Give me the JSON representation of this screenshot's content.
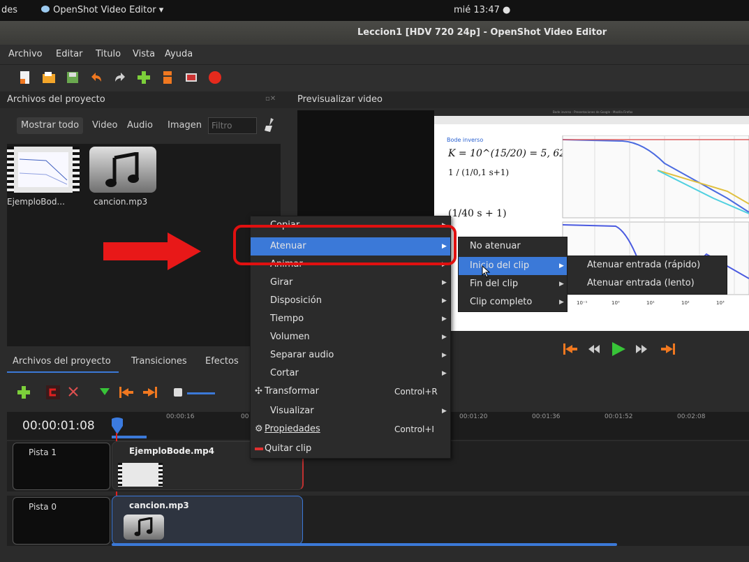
{
  "system_bar": {
    "activities": "des",
    "app_menu": "OpenShot Video Editor ▾",
    "clock": "mié 13:47 ●"
  },
  "window": {
    "title": "Leccion1 [HDV 720 24p] - OpenShot Video Editor"
  },
  "menu": [
    "Archivo",
    "Editar",
    "Titulo",
    "Vista",
    "Ayuda"
  ],
  "toolbar_icons": [
    "new-project-icon",
    "open-project-icon",
    "save-project-icon",
    "undo-icon",
    "redo-icon",
    "import-files-icon",
    "choose-profile-icon",
    "fullscreen-icon",
    "export-video-icon"
  ],
  "project_panel": {
    "title": "Archivos del proyecto",
    "filters": [
      "Mostrar todo",
      "Video",
      "Audio",
      "Imagen"
    ],
    "filter_placeholder": "Filtro",
    "files": [
      {
        "name": "EjemploBod...",
        "type": "video"
      },
      {
        "name": "cancion.mp3",
        "type": "audio"
      }
    ]
  },
  "preview_panel": {
    "title": "Previsualizar video"
  },
  "slide": {
    "window_title": "Bode inverso - Presentaciones de Google - Mozilla Firefox",
    "heading": "Bode inverso",
    "eq1": "K = 10^(15/20) = 5, 62",
    "eq_frac": "1 / (1/0,1 s+1)",
    "eq2": "(1/40 s + 1)",
    "axis_ticks": [
      "10⁻¹",
      "10⁰",
      "10¹",
      "10²",
      "10³"
    ]
  },
  "bottom_tabs": [
    "Archivos del proyecto",
    "Transiciones",
    "Efectos"
  ],
  "timeline": {
    "timecode": "00:00:01:08",
    "ticks": [
      "00:00:16",
      "00",
      "00:01:20",
      "00:01:36",
      "00:01:52",
      "00:02:08"
    ],
    "tracks": [
      {
        "name": "Pista 1",
        "clip": "EjemploBode.mp4"
      },
      {
        "name": "Pista 0",
        "clip": "cancion.mp3"
      }
    ]
  },
  "context_menu": {
    "items": [
      {
        "label": "Copiar",
        "submenu": true
      },
      {
        "label": "Atenuar",
        "submenu": true,
        "highlighted": true
      },
      {
        "label": "Animar",
        "submenu": true
      },
      {
        "label": "Girar",
        "submenu": true
      },
      {
        "label": "Disposición",
        "submenu": true
      },
      {
        "label": "Tiempo",
        "submenu": true
      },
      {
        "label": "Volumen",
        "submenu": true
      },
      {
        "label": "Separar audio",
        "submenu": true
      },
      {
        "label": "Cortar",
        "submenu": true
      },
      {
        "label": "Transformar",
        "shortcut": "Control+R"
      },
      {
        "label": "Visualizar",
        "submenu": true
      },
      {
        "label": "Propiedades",
        "shortcut": "Control+I"
      },
      {
        "label": "Quitar clip"
      }
    ],
    "fade_submenu": [
      "No atenuar",
      "Inicio del clip",
      "Fin del clip",
      "Clip completo"
    ],
    "start_submenu": [
      "Atenuar entrada (rápido)",
      "Atenuar entrada (lento)"
    ]
  },
  "colors": {
    "highlight": "#3b79d8",
    "annotation_red": "#e01010",
    "play_green": "#38c438",
    "accent_orange": "#f07820"
  }
}
